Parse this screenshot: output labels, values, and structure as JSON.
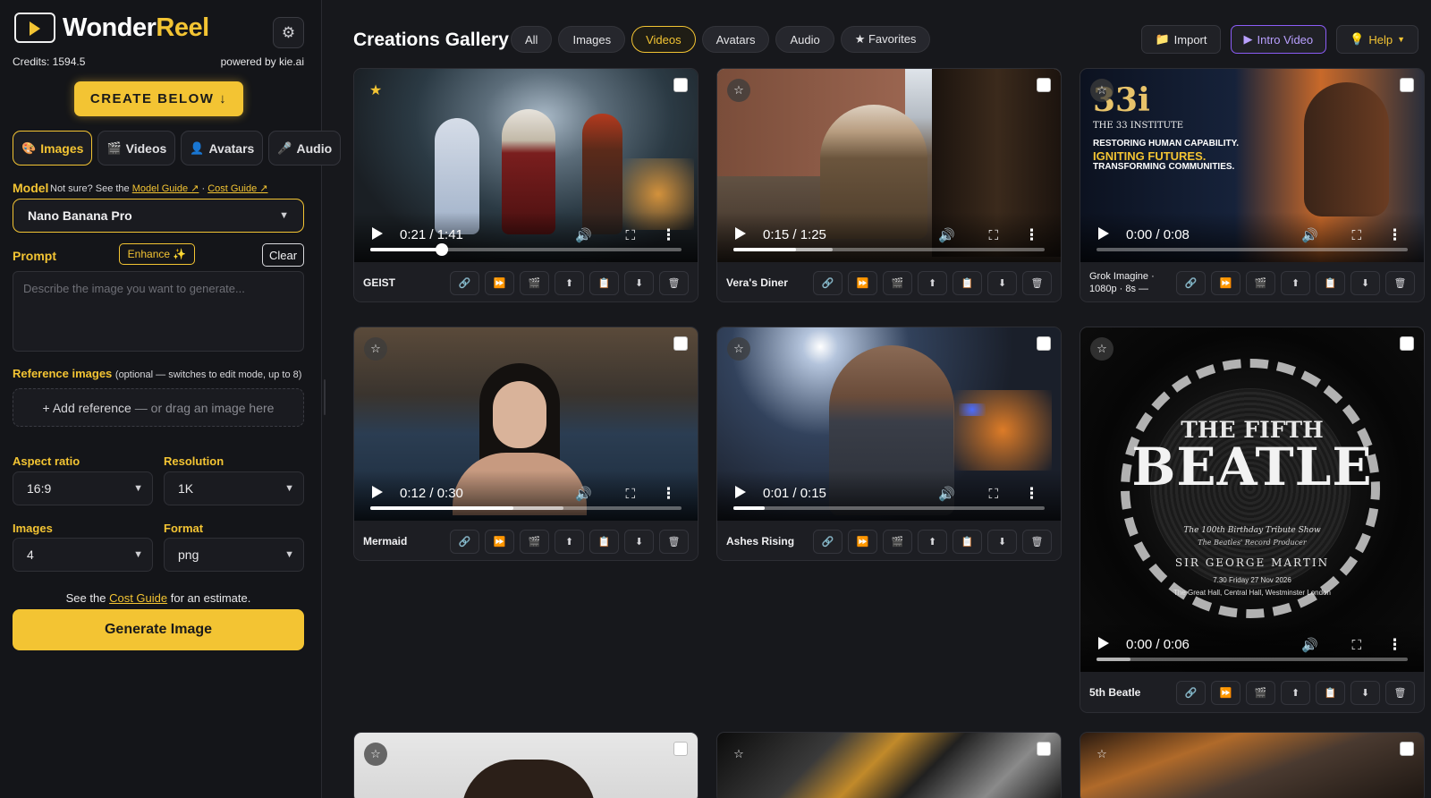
{
  "app": {
    "name_part1": "Wonder",
    "name_part2": "Reel",
    "credits": "Credits: 1594.5",
    "powered_by": "powered by kie.ai",
    "create_below": "CREATE BELOW ↓",
    "accent_color": "#f3c433"
  },
  "mode_tabs": [
    {
      "label": "Images",
      "icon": "palette-icon",
      "glyph": "🎨",
      "active": true
    },
    {
      "label": "Videos",
      "icon": "film-icon",
      "glyph": "🎬",
      "active": false
    },
    {
      "label": "Avatars",
      "icon": "avatar-icon",
      "glyph": "👤",
      "active": false
    },
    {
      "label": "Audio",
      "icon": "mic-icon",
      "glyph": "🎤",
      "active": false
    }
  ],
  "model": {
    "label": "Model",
    "hint_prefix": "Not sure? See the",
    "model_guide": "Model Guide ↗",
    "separator": "·",
    "cost_guide": "Cost Guide ↗",
    "selected": "Nano Banana Pro"
  },
  "prompt": {
    "label": "Prompt",
    "enhance": "Enhance ✨",
    "clear": "Clear",
    "placeholder": "Describe the image you want to generate..."
  },
  "reference": {
    "label": "Reference images",
    "note": "(optional — switches to edit mode, up to 8)",
    "add": "+ Add reference",
    "add_muted": "— or drag an image here"
  },
  "options": {
    "aspect_label": "Aspect ratio",
    "aspect_value": "16:9",
    "resolution_label": "Resolution",
    "resolution_value": "1K",
    "images_label": "Images",
    "images_value": "4",
    "format_label": "Format",
    "format_value": "png"
  },
  "cost_note": {
    "prefix": "See the",
    "link": "Cost Guide",
    "suffix": "for an estimate."
  },
  "generate": "Generate Image",
  "gallery": {
    "title": "Creations Gallery",
    "filters": [
      {
        "label": "All",
        "active": false
      },
      {
        "label": "Images",
        "active": false
      },
      {
        "label": "Videos",
        "active": true
      },
      {
        "label": "Avatars",
        "active": false
      },
      {
        "label": "Audio",
        "active": false
      },
      {
        "label": "★ Favorites",
        "active": false
      }
    ],
    "actions": {
      "import": "Import",
      "intro": "Intro Video",
      "help": "Help"
    },
    "cards": [
      {
        "name": "GEIST",
        "time": "0:21 / 1:41",
        "progress": 0.23,
        "buffered": 0.23,
        "favorite": true
      },
      {
        "name": "Vera's Diner",
        "time": "0:15 / 1:25",
        "progress": 0.2,
        "buffered": 0.32
      },
      {
        "name": "Grok Imagine · 1080p · 8s —",
        "time": "0:00 / 0:08",
        "progress": 0.0,
        "buffered": 0.0,
        "poster_title": "33i",
        "poster_sub": "THE 33 INSTITUTE",
        "poster_l1": "RESTORING HUMAN CAPABILITY.",
        "poster_l2": "IGNITING FUTURES.",
        "poster_l3": "TRANSFORMING COMMUNITIES."
      },
      {
        "name": "Mermaid",
        "time": "0:12 / 0:30",
        "progress": 0.46,
        "buffered": 0.62
      },
      {
        "name": "Ashes Rising",
        "time": "0:01 / 0:15",
        "progress": 0.1,
        "buffered": 0.1
      },
      {
        "name": "5th Beatle",
        "time": "0:00 / 0:06",
        "progress": 0.0,
        "buffered": 0.11,
        "poster_l1": "THE FIFTH",
        "poster_l2": "BEATLE",
        "poster_l3": "The 100th Birthday Tribute Show",
        "poster_l4": "The Beatles' Record Producer",
        "poster_l5": "SIR GEORGE MARTIN",
        "poster_l6": "7.30 Friday 27 Nov 2026",
        "poster_l7": "The Great Hall, Central Hall, Westminster London"
      }
    ],
    "card_actions": [
      {
        "name": "link-icon",
        "glyph": "🔗"
      },
      {
        "name": "extend-icon",
        "glyph": "⏩"
      },
      {
        "name": "clapper-icon",
        "glyph": "🎬"
      },
      {
        "name": "upload-icon",
        "glyph": "⬆"
      },
      {
        "name": "clipboard-icon",
        "glyph": "📋"
      },
      {
        "name": "download-icon",
        "glyph": "⬇"
      },
      {
        "name": "trash-icon",
        "glyph": "🗑"
      }
    ]
  }
}
